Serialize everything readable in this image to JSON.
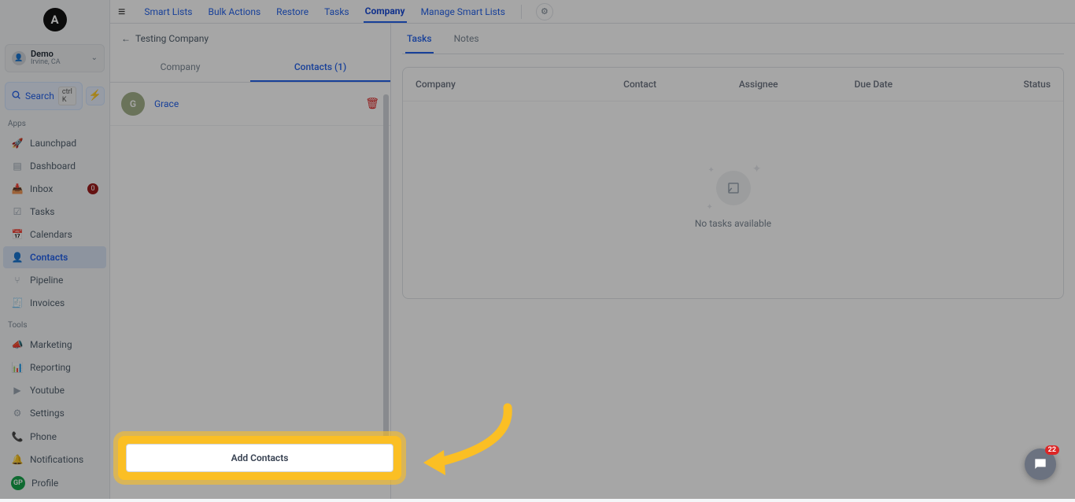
{
  "logo_letter": "A",
  "account": {
    "name": "Demo",
    "location": "Irvine, CA",
    "avatar_letter": ""
  },
  "search": {
    "label": "Search",
    "shortcut": "ctrl K"
  },
  "nav_sections": {
    "apps_label": "Apps",
    "tools_label": "Tools"
  },
  "nav": {
    "launchpad": "Launchpad",
    "dashboard": "Dashboard",
    "inbox": "Inbox",
    "inbox_badge": "0",
    "tasks": "Tasks",
    "calendars": "Calendars",
    "contacts": "Contacts",
    "pipeline": "Pipeline",
    "invoices": "Invoices",
    "marketing": "Marketing",
    "reporting": "Reporting",
    "youtube": "Youtube",
    "settings": "Settings",
    "phone": "Phone",
    "notifications": "Notifications",
    "profile": "Profile",
    "profile_avatar": "GP"
  },
  "topnav": {
    "smart_lists": "Smart Lists",
    "bulk_actions": "Bulk Actions",
    "restore": "Restore",
    "tasks": "Tasks",
    "company": "Company",
    "manage_smart_lists": "Manage Smart Lists"
  },
  "breadcrumb": {
    "back_arrow": "←",
    "label": "Testing Company"
  },
  "company_tabs": {
    "company": "Company",
    "contacts": "Contacts (1)"
  },
  "contact": {
    "initial": "G",
    "name": "Grace"
  },
  "add_contacts_label": "Add Contacts",
  "subtabs": {
    "tasks": "Tasks",
    "notes": "Notes"
  },
  "table_headers": {
    "company": "Company",
    "contact": "Contact",
    "assignee": "Assignee",
    "due_date": "Due Date",
    "status": "Status"
  },
  "empty_state_text": "No tasks available",
  "chat_badge": "22"
}
